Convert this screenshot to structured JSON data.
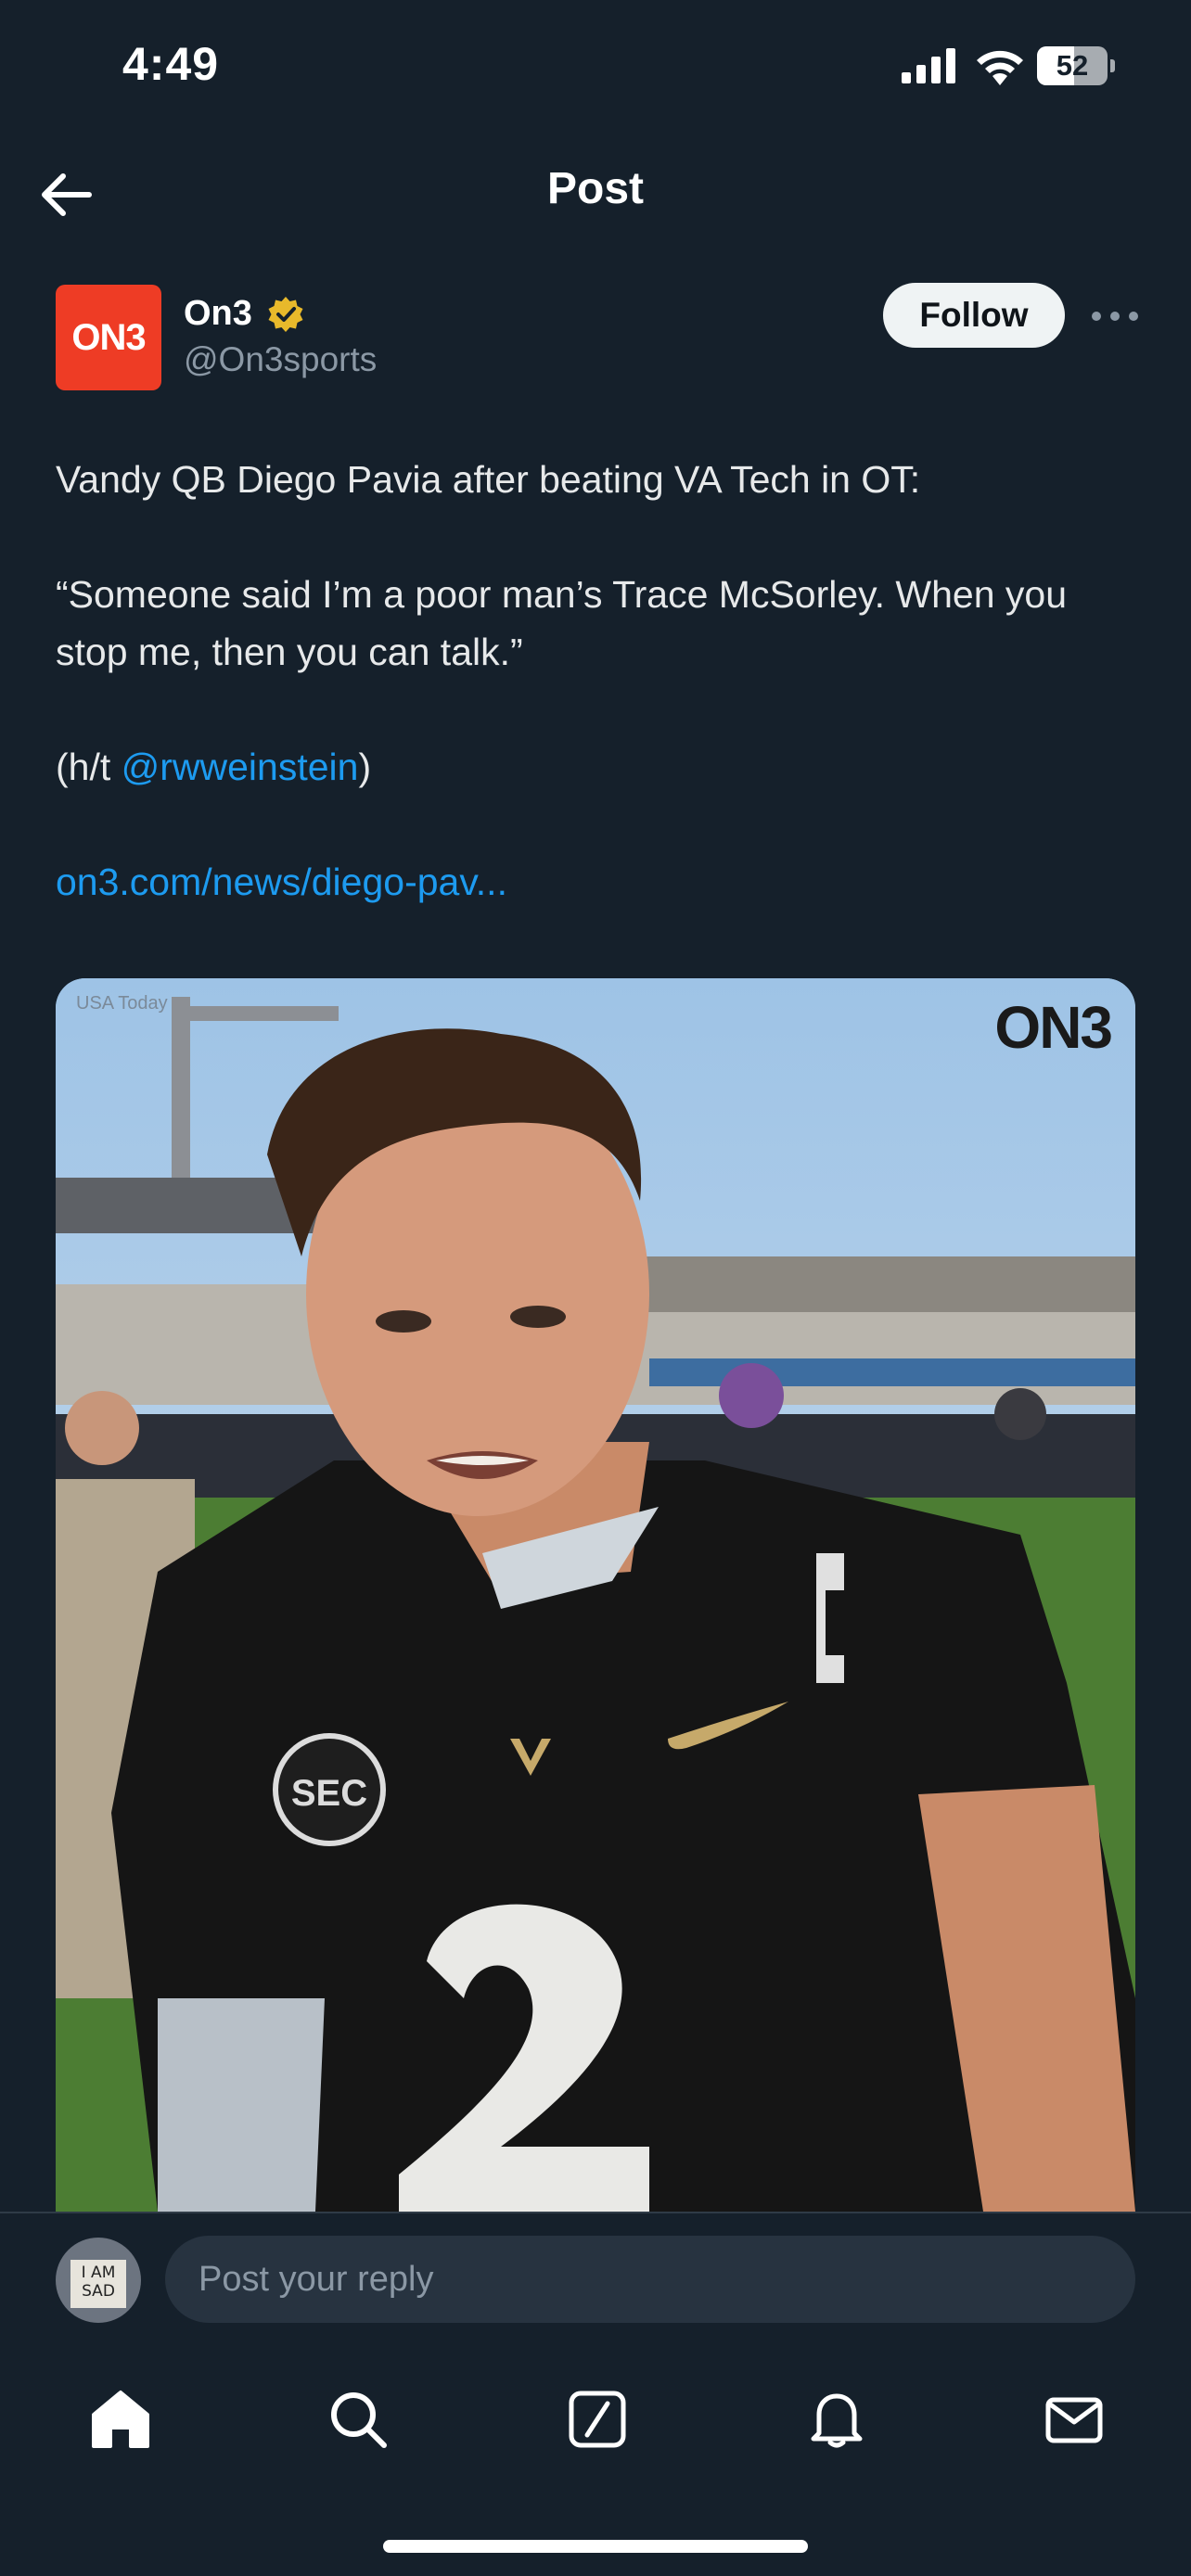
{
  "status_bar": {
    "time": "4:49",
    "battery_level": "52",
    "battery_fraction": 0.52
  },
  "header": {
    "title": "Post",
    "back_icon": "arrow-left-icon"
  },
  "author": {
    "avatar_text": "ON3",
    "name": "On3",
    "handle": "@On3sports",
    "verified_color": "#e8b92b",
    "follow_label": "Follow"
  },
  "tweet": {
    "line1": "Vandy QB Diego Pavia after beating VA Tech in OT:",
    "quote": "“Someone said I’m a poor man’s Trace McSorley. When you stop me, then you can talk.”",
    "ht_prefix": "(h/t ",
    "ht_mention": "@rwweinstein",
    "ht_suffix": ")",
    "link": "on3.com/news/diego-pav..."
  },
  "media": {
    "credit": "USA Today",
    "logo": "ON3"
  },
  "reply": {
    "avatar_sign": "I AM SAD",
    "placeholder": "Post your reply"
  },
  "tabs": [
    {
      "name": "home",
      "icon": "home-icon",
      "active": true
    },
    {
      "name": "search",
      "icon": "search-icon"
    },
    {
      "name": "grok",
      "icon": "grok-icon"
    },
    {
      "name": "notifications",
      "icon": "bell-icon"
    },
    {
      "name": "messages",
      "icon": "mail-icon"
    }
  ],
  "colors": {
    "background": "#15202b",
    "link": "#1d9bf0",
    "brand_on3": "#ee3c25"
  }
}
